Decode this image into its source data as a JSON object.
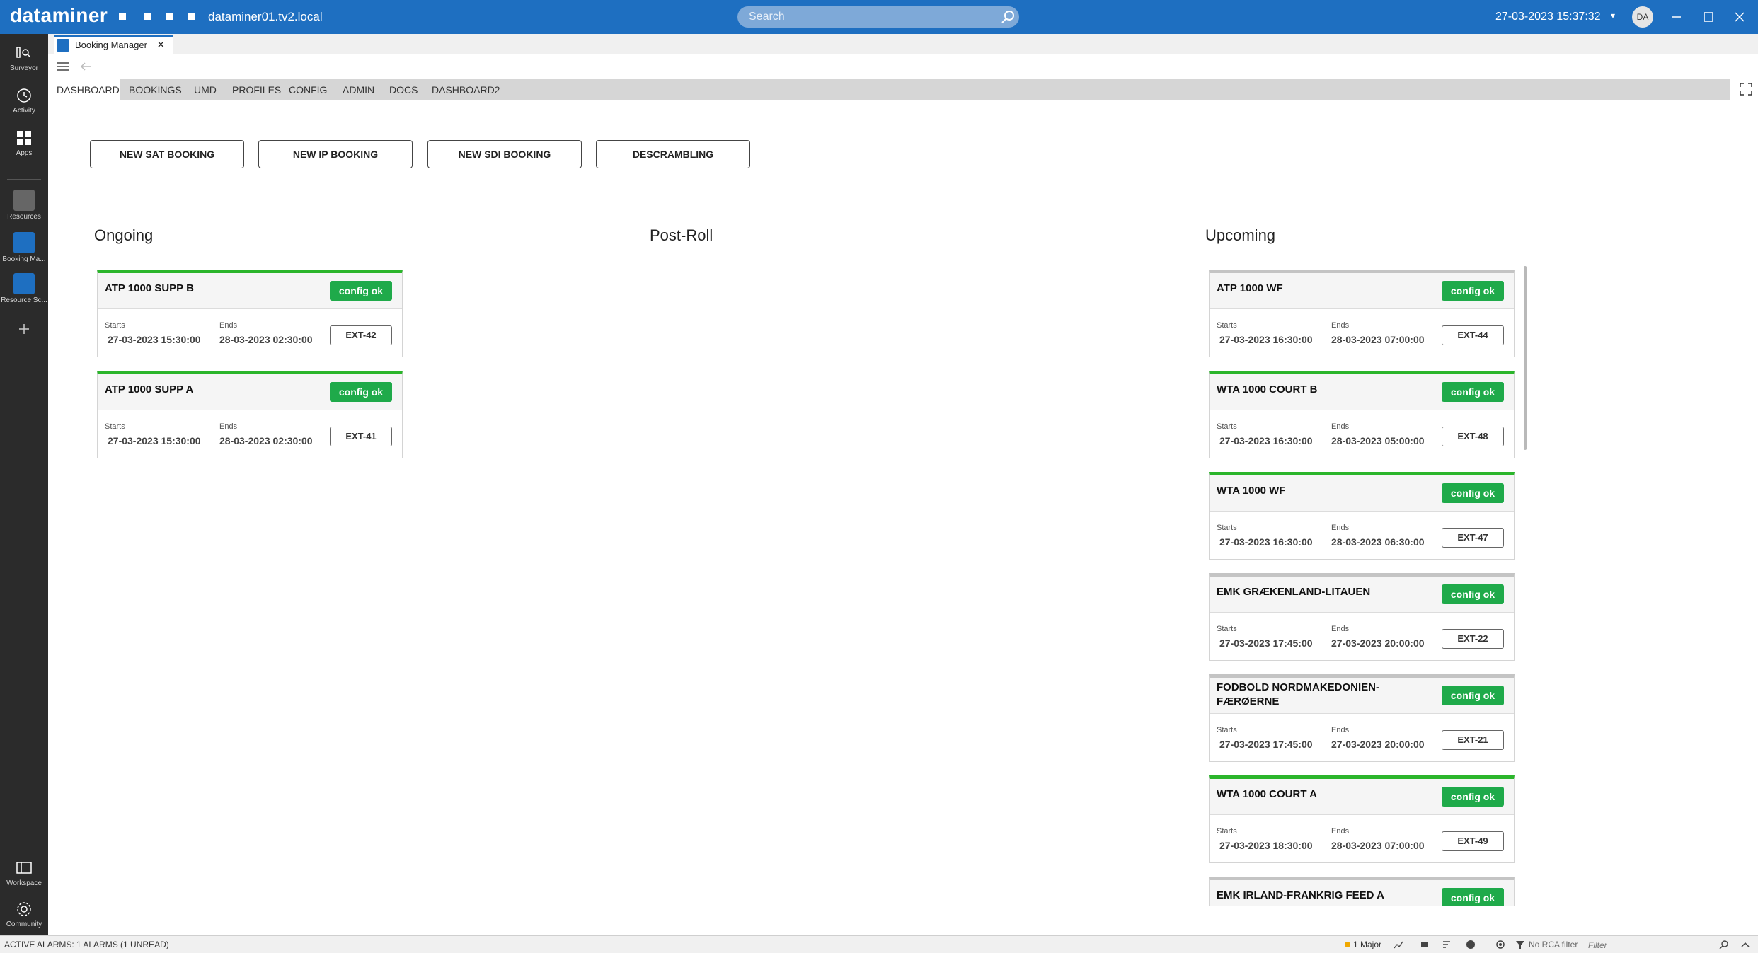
{
  "topbar": {
    "brand": "dataminer",
    "host": "dataminer01.tv2.local",
    "search_placeholder": "Search",
    "datetime": "27-03-2023 15:37:32",
    "avatar_initials": "DA",
    "color": "#1e6fc1"
  },
  "rail": {
    "items": [
      {
        "label": "Surveyor",
        "icon": "surveyor-icon"
      },
      {
        "label": "Activity",
        "icon": "activity-icon"
      },
      {
        "label": "Apps",
        "icon": "apps-icon"
      },
      {
        "label": "Resources",
        "icon": "resources-icon"
      },
      {
        "label": "Booking Ma...",
        "icon": "booking-manager-icon"
      },
      {
        "label": "Resource Sc...",
        "icon": "resource-scheduler-icon"
      }
    ],
    "bottom": [
      {
        "label": "Workspace",
        "icon": "workspace-icon"
      },
      {
        "label": "Community",
        "icon": "community-icon"
      }
    ]
  },
  "app_tab": {
    "label": "Booking Manager"
  },
  "nav": {
    "tabs": [
      "DASHBOARD",
      "BOOKINGS",
      "UMD",
      "PROFILES",
      "CONFIG",
      "ADMIN",
      "DOCS",
      "DASHBOARD2"
    ],
    "active": "DASHBOARD"
  },
  "actions": [
    "NEW SAT BOOKING",
    "NEW IP BOOKING",
    "NEW SDI BOOKING",
    "DESCRAMBLING"
  ],
  "columns": {
    "ongoing": "Ongoing",
    "postroll": "Post-Roll",
    "upcoming": "Upcoming"
  },
  "card_labels": {
    "starts": "Starts",
    "ends": "Ends"
  },
  "status_color": "#1faa4a",
  "ongoing": [
    {
      "title": "ATP 1000 SUPP B",
      "status": "config ok",
      "starts": "27-03-2023 15:30:00",
      "ends": "28-03-2023 02:30:00",
      "ext": "EXT-42",
      "bar": "green"
    },
    {
      "title": "ATP 1000 SUPP A",
      "status": "config ok",
      "starts": "27-03-2023 15:30:00",
      "ends": "28-03-2023 02:30:00",
      "ext": "EXT-41",
      "bar": "green"
    }
  ],
  "upcoming": [
    {
      "title": "ATP 1000 WF",
      "status": "config ok",
      "starts": "27-03-2023 16:30:00",
      "ends": "28-03-2023 07:00:00",
      "ext": "EXT-44",
      "bar": "grey"
    },
    {
      "title": "WTA 1000 COURT B",
      "status": "config ok",
      "starts": "27-03-2023 16:30:00",
      "ends": "28-03-2023 05:00:00",
      "ext": "EXT-48",
      "bar": "green"
    },
    {
      "title": "WTA 1000 WF",
      "status": "config ok",
      "starts": "27-03-2023 16:30:00",
      "ends": "28-03-2023 06:30:00",
      "ext": "EXT-47",
      "bar": "green"
    },
    {
      "title": "EMK GRÆKENLAND-LITAUEN",
      "status": "config ok",
      "starts": "27-03-2023 17:45:00",
      "ends": "27-03-2023 20:00:00",
      "ext": "EXT-22",
      "bar": "grey"
    },
    {
      "title": "FODBOLD NORDMAKEDONIEN-FÆRØERNE",
      "status": "config ok",
      "starts": "27-03-2023 17:45:00",
      "ends": "27-03-2023 20:00:00",
      "ext": "EXT-21",
      "bar": "grey"
    },
    {
      "title": "WTA 1000 COURT A",
      "status": "config ok",
      "starts": "27-03-2023 18:30:00",
      "ends": "28-03-2023 07:00:00",
      "ext": "EXT-49",
      "bar": "green"
    },
    {
      "title": "EMK IRLAND-FRANKRIG FEED A",
      "status": "config ok",
      "starts": "",
      "ends": "",
      "ext": "",
      "bar": "grey"
    }
  ],
  "statusbar": {
    "alarms": "ACTIVE ALARMS: 1 ALARMS (1 UNREAD)",
    "severity": "1 Major",
    "rca": "No RCA filter",
    "filter_placeholder": "Filter"
  }
}
